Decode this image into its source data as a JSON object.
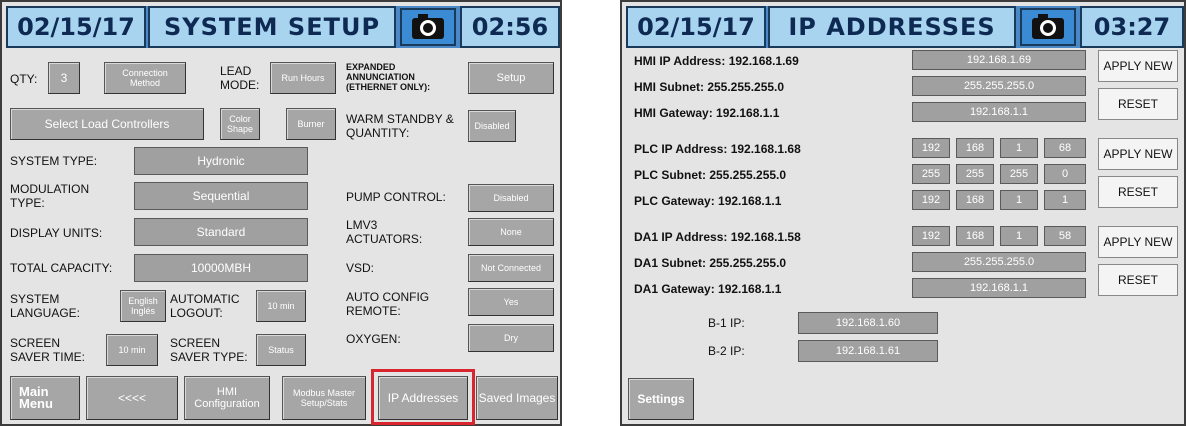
{
  "left": {
    "date": "02/15/17",
    "title": "SYSTEM SETUP",
    "time": "02:56",
    "qty_label": "QTY:",
    "qty_value": "3",
    "connection_method": "Connection Method",
    "lead_mode_label": "LEAD MODE:",
    "lead_mode_value": "Run Hours",
    "expanded_label": "EXPANDED ANNUNCIATION (ETHERNET ONLY):",
    "setup_button": "Setup",
    "select_load_controllers": "Select Load Controllers",
    "color_shape": "Color Shape",
    "burner": "Burner",
    "warm_standby_label": "WARM STANDBY & QUANTITY:",
    "warm_standby_value": "Disabled",
    "system_type_label": "SYSTEM TYPE:",
    "system_type_value": "Hydronic",
    "modulation_type_label": "MODULATION TYPE:",
    "modulation_type_value": "Sequential",
    "pump_control_label": "PUMP CONTROL:",
    "pump_control_value": "Disabled",
    "display_units_label": "DISPLAY UNITS:",
    "display_units_value": "Standard",
    "lmv3_label": "LMV3 ACTUATORS:",
    "lmv3_value": "None",
    "total_capacity_label": "TOTAL CAPACITY:",
    "total_capacity_value": "10000MBH",
    "vsd_label": "VSD:",
    "vsd_value": "Not Connected",
    "system_language_label": "SYSTEM LANGUAGE:",
    "system_language_value": "English Inglés",
    "auto_logout_label": "AUTOMATIC LOGOUT:",
    "auto_logout_value": "10 min",
    "auto_config_label": "AUTO CONFIG REMOTE:",
    "auto_config_value": "Yes",
    "screen_saver_time_label": "SCREEN SAVER TIME:",
    "screen_saver_time_value": "10 min",
    "screen_saver_type_label": "SCREEN SAVER TYPE:",
    "screen_saver_type_value": "Status",
    "oxygen_label": "OXYGEN:",
    "oxygen_value": "Dry",
    "nav": {
      "main_menu": "Main Menu",
      "back": "<<<<",
      "hmi_config": "HMI Configuration",
      "modbus": "Modbus Master Setup/Stats",
      "ip_addresses": "IP Addresses",
      "saved_images": "Saved Images"
    },
    "highlight_color": "#d9262e"
  },
  "right": {
    "date": "02/15/17",
    "title": "IP ADDRESSES",
    "time": "03:27",
    "hmi_ip": "HMI IP Address: 192.168.1.69",
    "hmi_ip_field": "192.168.1.69",
    "hmi_subnet": "HMI Subnet: 255.255.255.0",
    "hmi_subnet_field": "255.255.255.0",
    "hmi_gateway": "HMI Gateway: 192.168.1.1",
    "hmi_gateway_field": "192.168.1.1",
    "plc_ip": "PLC IP Address: 192.168.1.68",
    "plc_ip_octets": [
      "192",
      "168",
      "1",
      "68"
    ],
    "plc_subnet": "PLC Subnet: 255.255.255.0",
    "plc_subnet_octets": [
      "255",
      "255",
      "255",
      "0"
    ],
    "plc_gateway": "PLC Gateway: 192.168.1.1",
    "plc_gateway_octets": [
      "192",
      "168",
      "1",
      "1"
    ],
    "da1_ip": "DA1 IP Address: 192.168.1.58",
    "da1_ip_octets": [
      "192",
      "168",
      "1",
      "58"
    ],
    "da1_subnet": "DA1 Subnet: 255.255.255.0",
    "da1_subnet_field": "255.255.255.0",
    "da1_gateway": "DA1 Gateway: 192.168.1.1",
    "da1_gateway_field": "192.168.1.1",
    "apply_new": "APPLY NEW",
    "reset": "RESET",
    "b1_label": "B-1 IP:",
    "b1_value": "192.168.1.60",
    "b2_label": "B-2 IP:",
    "b2_value": "192.168.1.61",
    "settings": "Settings"
  }
}
